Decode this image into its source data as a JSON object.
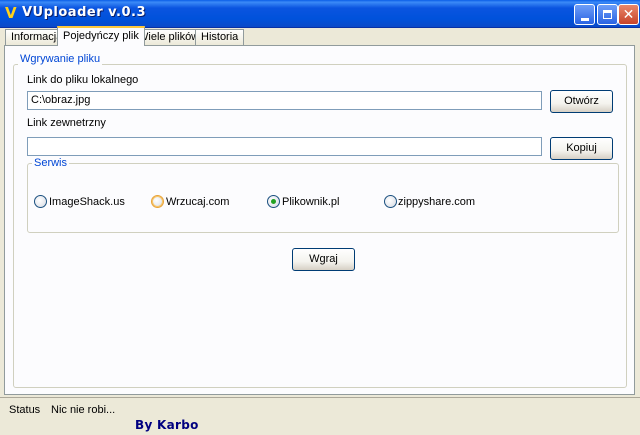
{
  "window": {
    "title": "VUploader v.0.3",
    "app_icon_glyph": "V",
    "icons": {
      "app": "vuploader-icon",
      "minimize": "minimize-icon",
      "maximize": "maximize-icon",
      "close": "close-icon"
    }
  },
  "tabs": [
    {
      "label": "Informacja",
      "active": false
    },
    {
      "label": "Pojedyńczy plik",
      "active": true
    },
    {
      "label": "Wiele plików",
      "active": false
    },
    {
      "label": "Historia",
      "active": false
    }
  ],
  "upload_group": {
    "legend": "Wgrywanie pliku",
    "local_file": {
      "label": "Link do pliku lokalnego",
      "value": "C:\\obraz.jpg",
      "browse_button": "Otwórz"
    },
    "external_link": {
      "label": "Link zewnetrzny",
      "value": "",
      "copy_button": "Kopiuj"
    },
    "service_group": {
      "legend": "Serwis",
      "options": [
        {
          "label": "ImageShack.us",
          "selected": false
        },
        {
          "label": "Wrzucaj.com",
          "selected": false,
          "hovered": true
        },
        {
          "label": "Plikownik.pl",
          "selected": true
        },
        {
          "label": "zippyshare.com",
          "selected": false
        }
      ]
    },
    "upload_button": "Wgraj"
  },
  "status": {
    "label": "Status",
    "text": "Nic nie robi...",
    "brand": "By Karbo"
  },
  "colors": {
    "titlebar": "#0052db",
    "legend_text": "#0046d5",
    "radio_selected": "#21a121",
    "brand": "#000080"
  }
}
